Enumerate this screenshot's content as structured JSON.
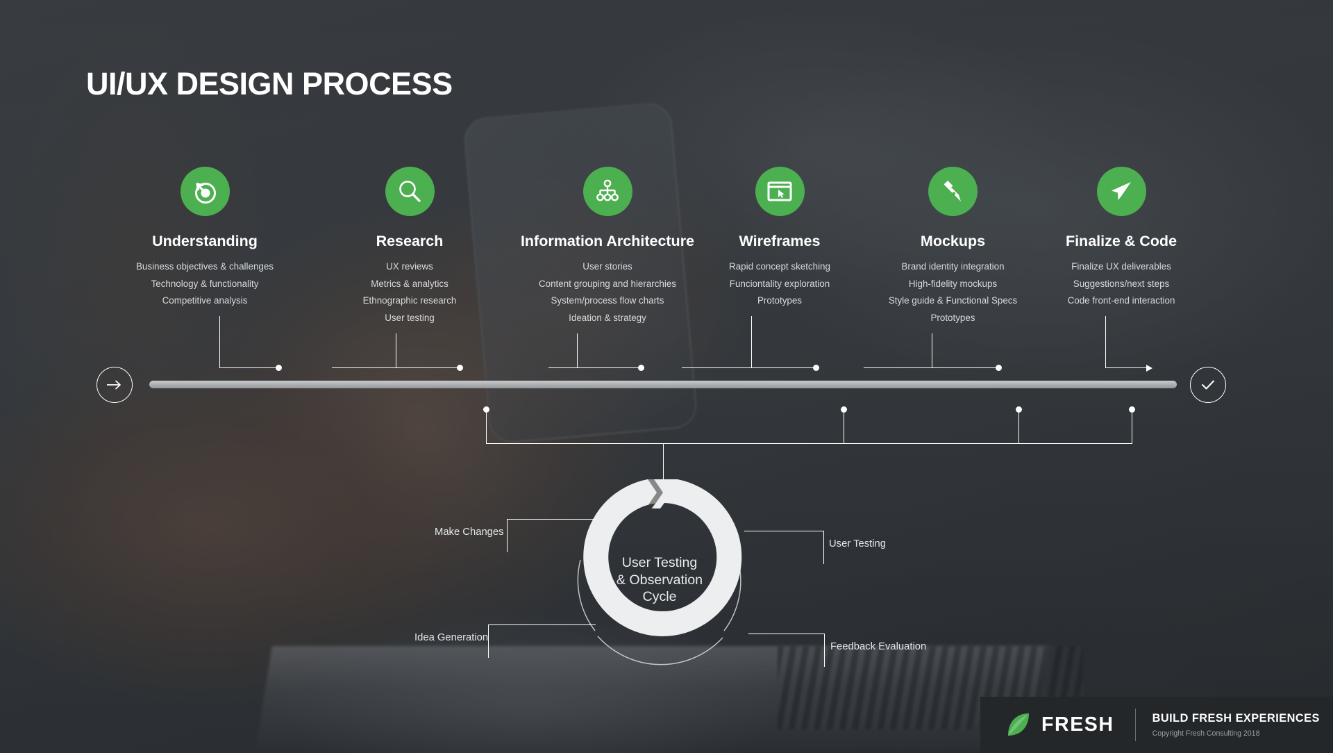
{
  "title": "UI/UX DESIGN PROCESS",
  "colors": {
    "accent": "#4caf50",
    "background": "#33373a",
    "bar": "#b2b5b7",
    "footer_bg": "#242729",
    "text": "#ffffff"
  },
  "steps": [
    {
      "icon": "target-arrow-icon",
      "title": "Understanding",
      "items": [
        "Business objectives & challenges",
        "Technology & functionality",
        "Competitive analysis"
      ]
    },
    {
      "icon": "magnifier-icon",
      "title": "Research",
      "items": [
        "UX reviews",
        "Metrics & analytics",
        "Ethnographic research",
        "User testing"
      ]
    },
    {
      "icon": "sitemap-icon",
      "title": "Information Architecture",
      "items": [
        "User stories",
        "Content grouping and hierarchies",
        "System/process flow charts",
        "Ideation & strategy"
      ]
    },
    {
      "icon": "browser-cursor-icon",
      "title": "Wireframes",
      "items": [
        "Rapid concept sketching",
        "Funciontality exploration",
        "Prototypes"
      ]
    },
    {
      "icon": "pen-nib-icon",
      "title": "Mockups",
      "items": [
        "Brand identity integration",
        "High-fidelity mockups",
        "Style guide & Functional Specs",
        "Prototypes"
      ]
    },
    {
      "icon": "paper-plane-icon",
      "title": "Finalize & Code",
      "items": [
        "Finalize UX deliverables",
        "Suggestions/next steps",
        "Code front-end interaction"
      ]
    }
  ],
  "timeline": {
    "start_icon": "arrow-right-icon",
    "end_icon": "check-icon"
  },
  "cycle": {
    "center_line1": "User Testing",
    "center_line2": "& Observation",
    "center_line3": "Cycle",
    "labels": {
      "top_left": "Make Changes",
      "bottom_left": "Idea Generation",
      "top_right": "User Testing",
      "bottom_right": "Feedback Evaluation"
    }
  },
  "footer": {
    "logo_icon": "leaf-icon",
    "brand": "FRESH",
    "tagline": "BUILD FRESH EXPERIENCES",
    "copyright": "Copyright Fresh Consulting 2018"
  }
}
